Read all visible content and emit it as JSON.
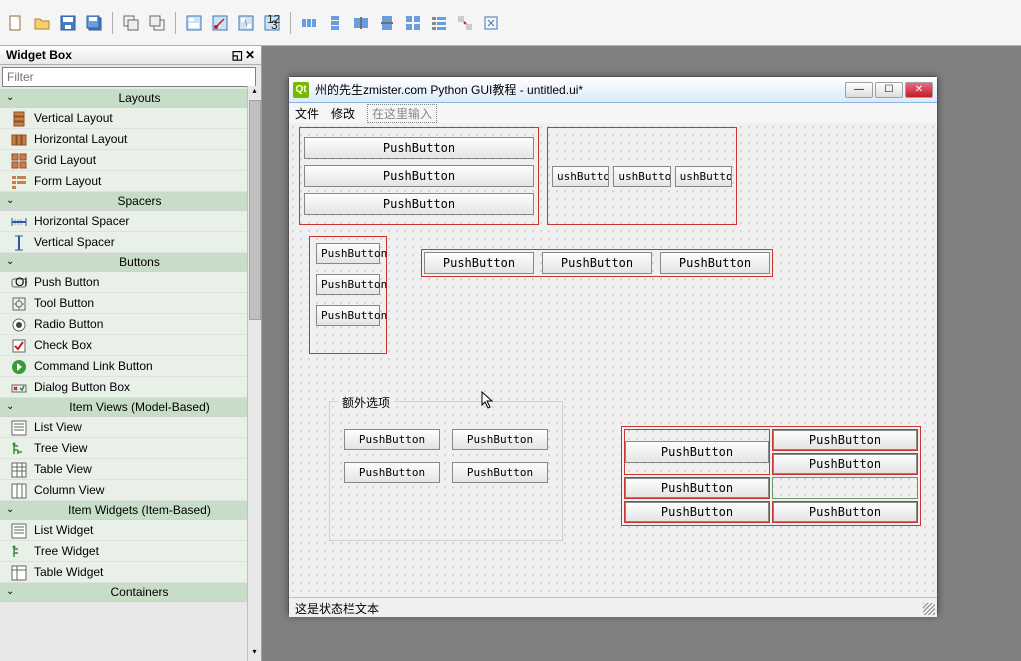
{
  "toolbar": {
    "icons": [
      "new-file",
      "open-file",
      "save-file",
      "save-all",
      "duplicate",
      "copy",
      "paste",
      "undo",
      "redo",
      "record",
      "run",
      "columns",
      "grid-remove",
      "align-left",
      "align-center",
      "align-distribute",
      "grid-h",
      "grid-v",
      "grid",
      "form-layout",
      "text-edit",
      "split",
      "preview"
    ]
  },
  "widget_box": {
    "title": "Widget Box",
    "filter_placeholder": "Filter",
    "categories": [
      {
        "name": "Layouts",
        "items": [
          "Vertical Layout",
          "Horizontal Layout",
          "Grid Layout",
          "Form Layout"
        ]
      },
      {
        "name": "Spacers",
        "items": [
          "Horizontal Spacer",
          "Vertical Spacer"
        ]
      },
      {
        "name": "Buttons",
        "items": [
          "Push Button",
          "Tool Button",
          "Radio Button",
          "Check Box",
          "Command Link Button",
          "Dialog Button Box"
        ]
      },
      {
        "name": "Item Views (Model-Based)",
        "items": [
          "List View",
          "Tree View",
          "Table View",
          "Column View"
        ]
      },
      {
        "name": "Item Widgets (Item-Based)",
        "items": [
          "List Widget",
          "Tree Widget",
          "Table Widget"
        ]
      },
      {
        "name": "Containers",
        "items": []
      }
    ]
  },
  "designer_window": {
    "title": "州的先生zmister.com Python GUI教程 - untitled.ui*",
    "menu": {
      "file": "文件",
      "edit": "修改",
      "type_here": "在这里输入"
    },
    "status_text": "这是状态栏文本",
    "buttons": {
      "push": "PushButton",
      "push_trunc": "ushButton",
      "groupbox_title": "额外选项"
    }
  }
}
